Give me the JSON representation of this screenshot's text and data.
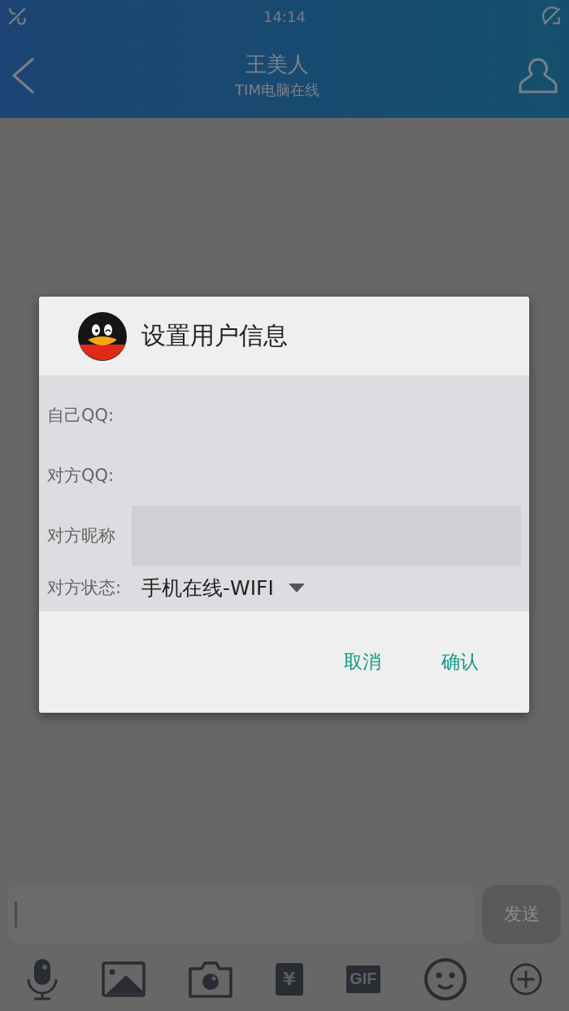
{
  "status_bar": {
    "time": "14:14"
  },
  "header": {
    "title": "王美人",
    "subtitle": "TIM电脑在线"
  },
  "dialog": {
    "title": "设置用户信息",
    "fields": [
      {
        "kind": "label",
        "label": "自己QQ:"
      },
      {
        "kind": "label",
        "label": "对方QQ:"
      },
      {
        "kind": "input",
        "label": "对方昵称"
      },
      {
        "kind": "select",
        "label": "对方状态:",
        "value": "手机在线-WIFI"
      }
    ],
    "buttons": [
      "取消",
      "确认"
    ]
  },
  "composer": {
    "send": "发送"
  },
  "toolbar": [
    {
      "kind": "mic"
    },
    {
      "kind": "image"
    },
    {
      "kind": "camera"
    },
    {
      "kind": "redpacket",
      "text": "¥"
    },
    {
      "kind": "gif",
      "text": "GIF"
    },
    {
      "kind": "emoji"
    },
    {
      "kind": "plus"
    }
  ]
}
